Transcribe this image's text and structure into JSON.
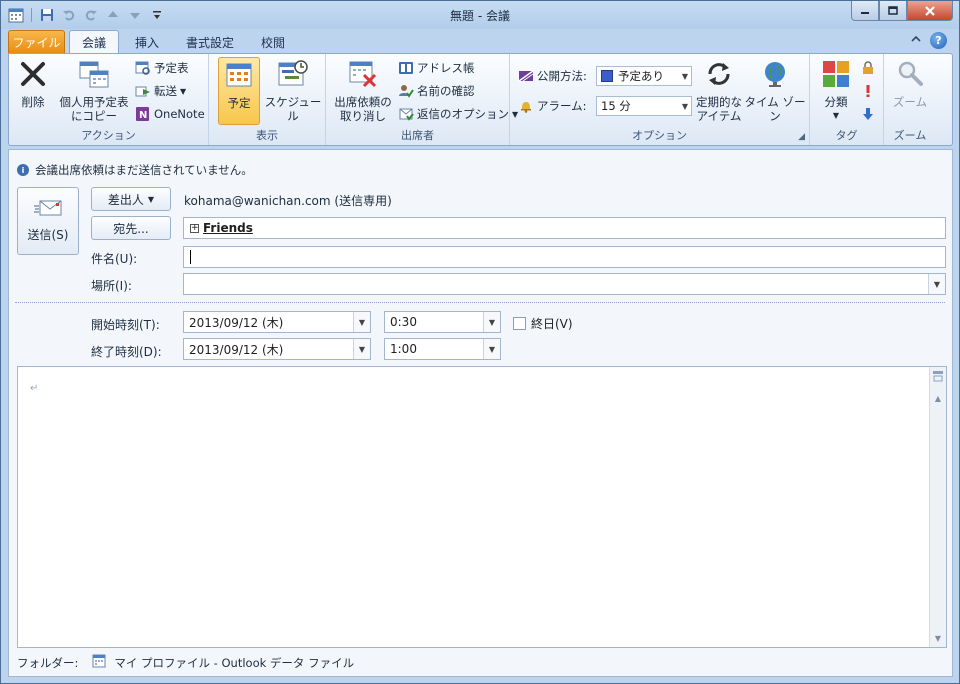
{
  "window": {
    "title": "無題 - 会議"
  },
  "tabs": {
    "file": "ファイル",
    "meeting": "会議",
    "insert": "挿入",
    "format": "書式設定",
    "review": "校閲"
  },
  "ribbon": {
    "action": {
      "label": "アクション",
      "delete": "削除",
      "copy_personal_1": "個人用予定表",
      "copy_personal_2": "にコピー",
      "calendar": "予定表",
      "forward": "転送",
      "onenote": "OneNote"
    },
    "show": {
      "label": "表示",
      "appointment": "予定",
      "schedule": "スケジュール"
    },
    "attendees": {
      "label": "出席者",
      "cancel_1": "出席依頼の",
      "cancel_2": "取り消し",
      "address_book": "アドレス帳",
      "check_names": "名前の確認",
      "response_options": "返信のオプション"
    },
    "options": {
      "label": "オプション",
      "show_as_label": "公開方法:",
      "show_as_value": "予定あり",
      "reminder_label": "アラーム:",
      "reminder_value": "15 分",
      "recurrence_1": "定期的な",
      "recurrence_2": "アイテム",
      "time_zones": "タイム ゾーン"
    },
    "tags": {
      "label": "タグ",
      "categorize": "分類"
    },
    "zoom": {
      "label": "ズーム",
      "zoom": "ズーム"
    }
  },
  "form": {
    "info": "会議出席依頼はまだ送信されていません。",
    "send": "送信(S)",
    "from_button": "差出人",
    "from_value": "kohama@wanichan.com (送信専用)",
    "to_button": "宛先...",
    "to_value": "Friends",
    "subject_label": "件名(U):",
    "subject_value": "",
    "location_label": "場所(I):",
    "location_value": "",
    "start_label": "開始時刻(T):",
    "start_date": "2013/09/12 (木)",
    "start_time": "0:30",
    "end_label": "終了時刻(D):",
    "end_date": "2013/09/12 (木)",
    "end_time": "1:00",
    "all_day": "終日(V)",
    "paragraph_mark": "↵"
  },
  "footer": {
    "folder_label": "フォルダー:",
    "folder_value": "マイ プロファイル - Outlook データ ファイル"
  }
}
